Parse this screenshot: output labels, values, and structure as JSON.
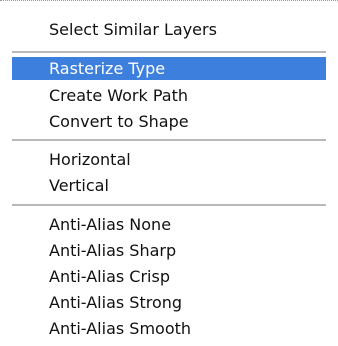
{
  "menu": {
    "items": [
      {
        "label": "Select Similar Layers"
      },
      {
        "label": "Rasterize Type",
        "highlighted": true
      },
      {
        "label": "Create Work Path"
      },
      {
        "label": "Convert to Shape"
      },
      {
        "label": "Horizontal"
      },
      {
        "label": "Vertical"
      },
      {
        "label": "Anti-Alias None"
      },
      {
        "label": "Anti-Alias Sharp"
      },
      {
        "label": "Anti-Alias Crisp"
      },
      {
        "label": "Anti-Alias Strong"
      },
      {
        "label": "Anti-Alias Smooth"
      }
    ]
  },
  "colors": {
    "highlight_background": "#3d7fdc",
    "highlight_text": "#ffffff",
    "text": "#111111",
    "separator": "#b9b9b9"
  }
}
